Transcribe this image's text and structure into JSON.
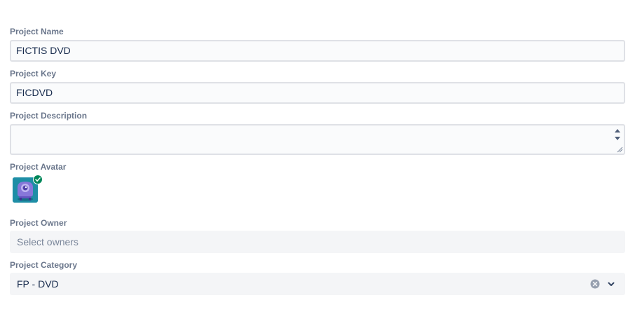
{
  "fields": {
    "name": {
      "label": "Project Name",
      "value": "FICTIS DVD"
    },
    "key": {
      "label": "Project Key",
      "value": "FICDVD"
    },
    "description": {
      "label": "Project Description",
      "value": ""
    },
    "avatar": {
      "label": "Project Avatar",
      "icon": "robot-avatar-icon",
      "status_icon": "check-circle-icon"
    },
    "owner": {
      "label": "Project Owner",
      "placeholder": "Select owners"
    },
    "category": {
      "label": "Project Category",
      "value": "FP - DVD"
    }
  },
  "colors": {
    "label": "#6b778c",
    "text": "#172b4d",
    "input_border": "#dfe1e6",
    "avatar_bg": "#1e8ea6",
    "check": "#00875a"
  }
}
